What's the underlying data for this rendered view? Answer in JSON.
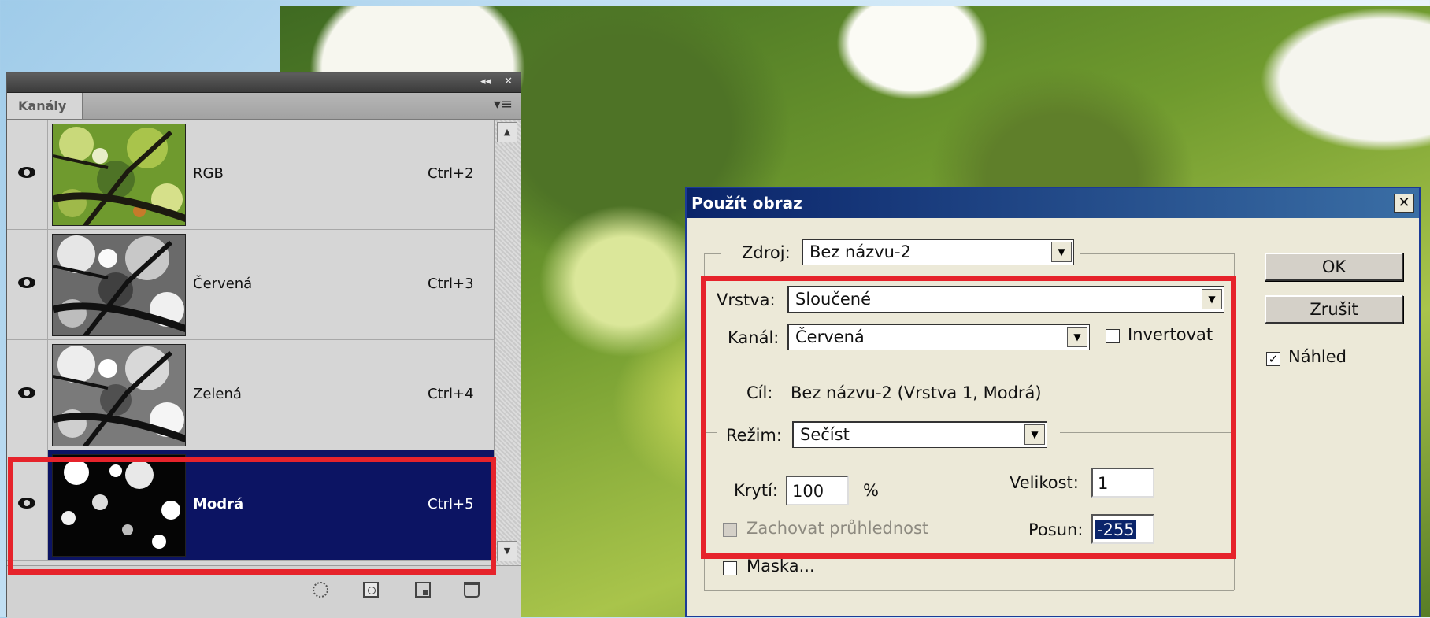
{
  "panel": {
    "tab_label": "Kanály",
    "collapse_glyph": "◂◂",
    "close_glyph": "✕",
    "menu_glyph": "▾≡",
    "channels": [
      {
        "name": "RGB",
        "shortcut": "Ctrl+2",
        "selected": false
      },
      {
        "name": "Červená",
        "shortcut": "Ctrl+3",
        "selected": false
      },
      {
        "name": "Zelená",
        "shortcut": "Ctrl+4",
        "selected": false
      },
      {
        "name": "Modrá",
        "shortcut": "Ctrl+5",
        "selected": true
      }
    ]
  },
  "dialog": {
    "title": "Použít obraz",
    "close_glyph": "✕",
    "source": {
      "label": "Zdroj:",
      "value": "Bez názvu-2"
    },
    "layer": {
      "label": "Vrstva:",
      "value": "Sloučené"
    },
    "channel": {
      "label": "Kanál:",
      "value": "Červená"
    },
    "invert": {
      "label": "Invertovat",
      "checked": false
    },
    "target": {
      "label": "Cíl:",
      "value": "Bez názvu-2 (Vrstva 1, Modrá)"
    },
    "blending": {
      "label": "Režim:",
      "value": "Sečíst"
    },
    "opacity": {
      "label": "Krytí:",
      "value": "100",
      "unit": "%"
    },
    "scale": {
      "label": "Velikost:",
      "value": "1"
    },
    "preserve_transparency": {
      "label": "Zachovat průhlednost",
      "checked": false,
      "disabled": true
    },
    "offset": {
      "label": "Posun:",
      "value": "-255"
    },
    "mask": {
      "label": "Maska...",
      "checked": false
    },
    "ok_label": "OK",
    "cancel_label": "Zrušit",
    "preview": {
      "label": "Náhled",
      "checked": true
    },
    "check_glyph": "✓",
    "arrow_glyph": "▼"
  },
  "colors": {
    "highlight": "#e6232b",
    "selection": "#0c1463",
    "title_bar": "#0a246a"
  }
}
